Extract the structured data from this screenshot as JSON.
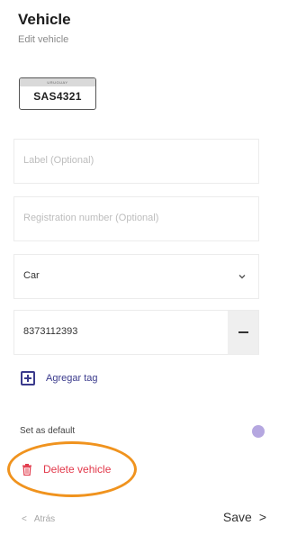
{
  "header": {
    "title": "Vehicle",
    "subtitle": "Edit vehicle"
  },
  "plate": {
    "country": "URUGUAY",
    "number": "SAS4321"
  },
  "form": {
    "label_placeholder": "Label (Optional)",
    "registration_placeholder": "Registration number (Optional)",
    "vehicle_type": "Car",
    "tag_number": "8373112393"
  },
  "add_tag_label": "Agregar tag",
  "default": {
    "label": "Set as default",
    "enabled": false
  },
  "delete_label": "Delete vehicle",
  "footer": {
    "back_glyph": "<",
    "back_label": "Atrás",
    "save_label": "Save",
    "save_glyph": ">"
  },
  "colors": {
    "accent": "#3a3a8c",
    "danger": "#e2384a",
    "highlight": "#f0931e",
    "toggle": "#b5a7e0"
  },
  "icons": {
    "chevron": "chevron-down-icon",
    "remove": "minus-icon",
    "add": "plus-square-icon",
    "delete": "trash-icon"
  }
}
